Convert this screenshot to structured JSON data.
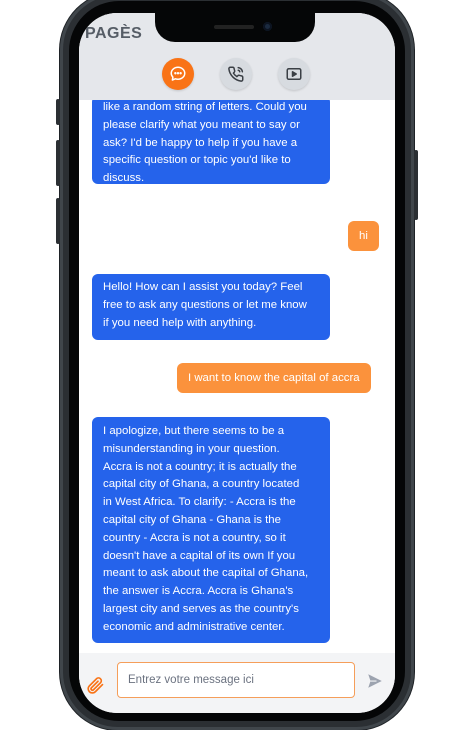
{
  "header": {
    "logo": "PAGÈS",
    "buttons": [
      {
        "icon": "chat-bubble-icon",
        "active": true
      },
      {
        "icon": "phone-call-icon",
        "active": false
      },
      {
        "icon": "video-play-icon",
        "active": false
      }
    ]
  },
  "messages": [
    {
      "role": "assistant",
      "lines": [
        "like a random string of letters. Could you",
        "please clarify what you meant to say or",
        "ask? I'd be happy to help if you have a",
        "specific question or topic you'd like to",
        "discuss."
      ]
    },
    {
      "role": "user",
      "lines": [
        "hi"
      ]
    },
    {
      "role": "assistant",
      "lines": [
        "Hello! How can I assist you today? Feel",
        "free to ask any questions or let me know",
        "if you need help with anything."
      ]
    },
    {
      "role": "user",
      "lines": [
        "I want to know the capital of accra"
      ]
    },
    {
      "role": "assistant",
      "lines": [
        "I apologize, but there seems to be a",
        "misunderstanding in your question.",
        "Accra is not a country; it is actually the",
        "capital city of Ghana, a country located",
        "in West Africa. To clarify: - Accra is the",
        "capital city of Ghana - Ghana is the",
        "country - Accra is not a country, so it",
        "doesn't have a capital of its own If you",
        "meant to ask about the capital of Ghana,",
        "the answer is Accra. Accra is Ghana's",
        "largest city and serves as the country's",
        "economic and administrative center."
      ]
    }
  ],
  "composer": {
    "placeholder": "Entrez votre message ici",
    "value": ""
  },
  "colors": {
    "accent": "#f97316",
    "bot_bubble": "#2563eb",
    "user_bubble": "#fb923c",
    "header_bg": "#e5e7eb"
  }
}
